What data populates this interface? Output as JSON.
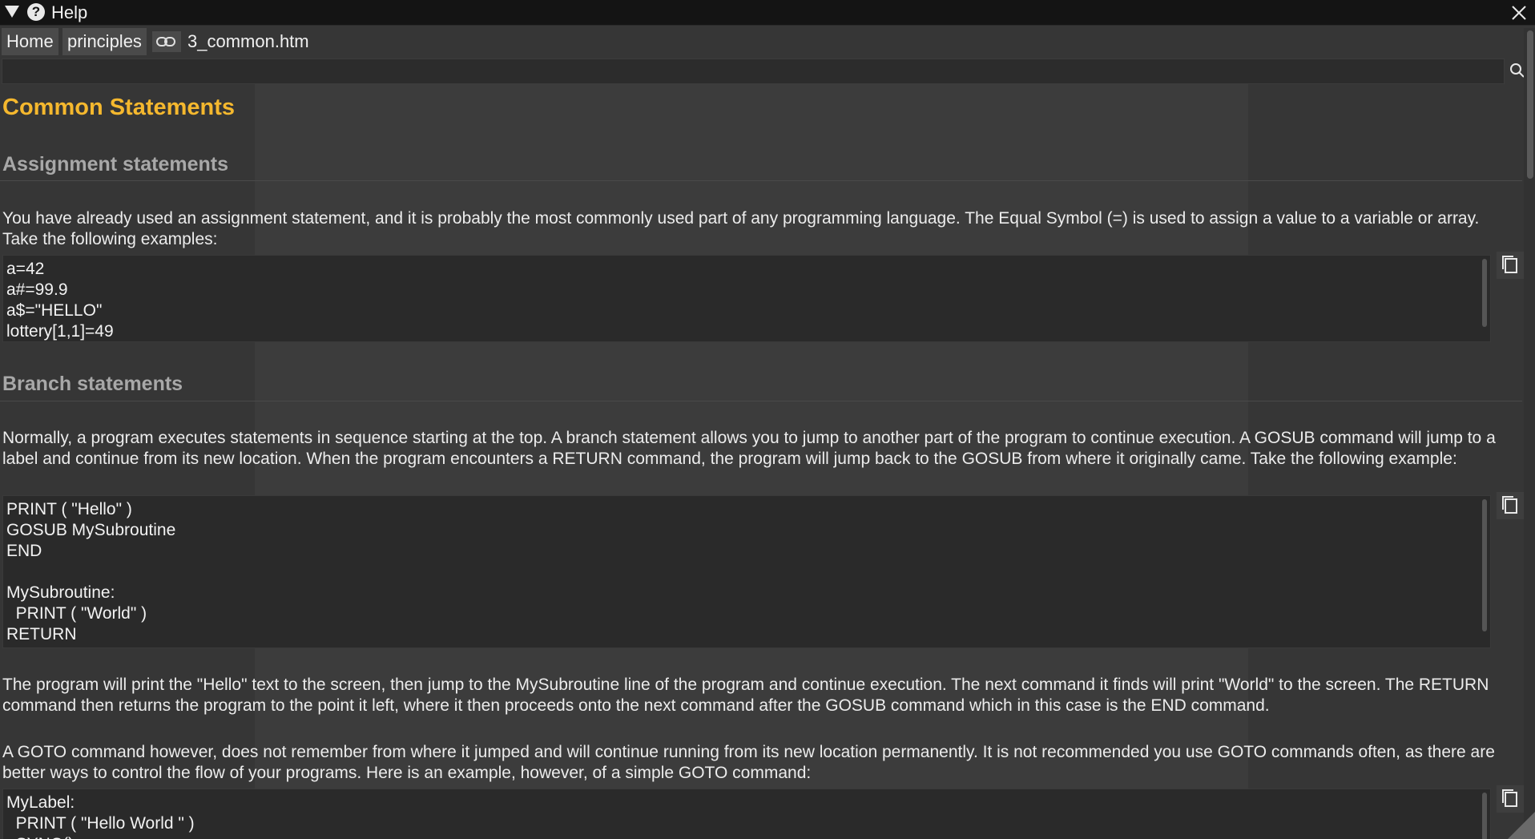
{
  "window": {
    "title": "Help"
  },
  "breadcrumb": {
    "items": [
      "Home",
      "principles"
    ],
    "file": "3_common.htm"
  },
  "search": {
    "value": ""
  },
  "doc": {
    "title": "Common Statements",
    "assignment": {
      "heading": "Assignment statements",
      "paragraph": "You have already used an assignment statement, and it is probably the most commonly used part of any programming language. The Equal Symbol (=) is used to assign a value to a variable or array. Take the following examples:",
      "code": "a=42\na#=99.9\na$=\"HELLO\"\nlottery[1,1]=49"
    },
    "branch": {
      "heading": "Branch statements",
      "paragraph": "Normally, a program executes statements in sequence starting at the top. A branch statement allows you to jump to another part of the program to continue execution. A GOSUB command will jump to a label and continue from its new location. When the program encounters a RETURN command, the program will jump back to the GOSUB from where it originally came. Take the following example:",
      "code": "PRINT ( \"Hello\" )\nGOSUB MySubroutine\nEND\n\nMySubroutine:\n  PRINT ( \"World\" )\nRETURN",
      "paragraph2": "The program will print the \"Hello\" text to the screen, then jump to the MySubroutine line of the program and continue execution. The next command it finds will print \"World\" to the screen. The RETURN command then returns the program to the point it left, where it then proceeds onto the next command after the GOSUB command which in this case is the END command.",
      "paragraph3": "A GOTO command however, does not remember from where it jumped and will continue running from its new location permanently. It is not recommended you use GOTO commands often, as there are better ways to control the flow of your programs. Here is an example, however, of a simple GOTO command:",
      "code2": "MyLabel:\n  PRINT ( \"Hello World \" )\n  SYNC()"
    }
  },
  "icons": {
    "collapse": "triangle-down-icon",
    "help": "question-icon",
    "close": "close-icon",
    "link": "link-icon",
    "search": "search-icon",
    "copy": "copy-icon"
  },
  "colors": {
    "title": "#f5b82e",
    "heading": "#a8a8a8",
    "background": "#363636",
    "titlebar": "#141414"
  }
}
